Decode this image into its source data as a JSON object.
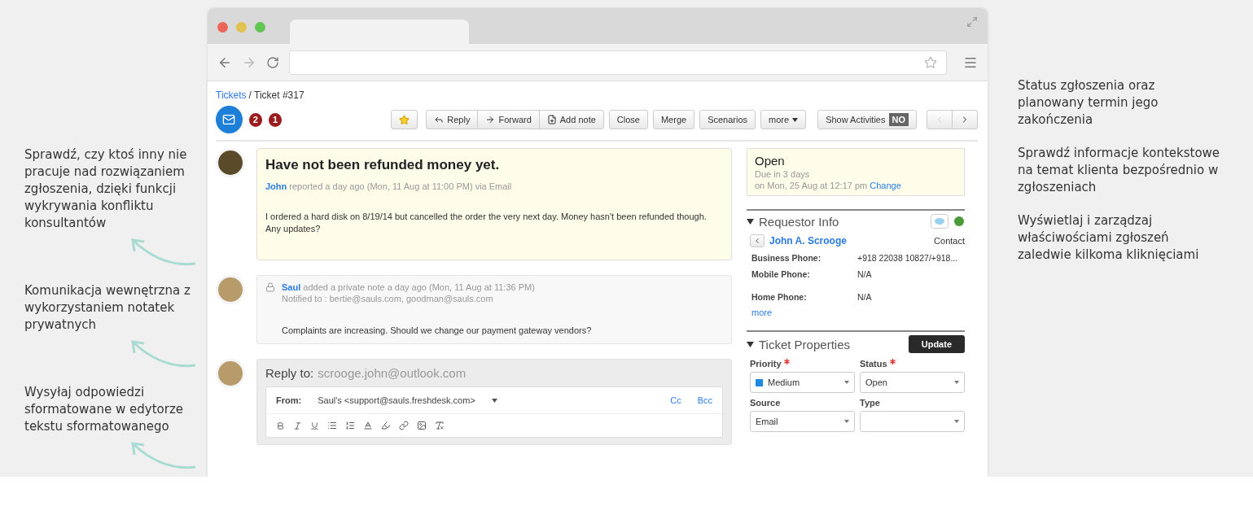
{
  "callouts_left": [
    {
      "text": "Sprawdź, czy ktoś inny nie pracuje nad rozwiązaniem zgłoszenia, dzięki funkcji wykrywania konfliktu konsultantów"
    },
    {
      "text": "Komunikacja wewnętrzna z wykorzystaniem notatek prywatnych"
    },
    {
      "text": "Wysyłaj odpowiedzi sformatowane w edytorze tekstu sformatowanego"
    }
  ],
  "callouts_right": [
    {
      "text": "Status zgłoszenia oraz planowany termin jego zakończenia"
    },
    {
      "text": "Sprawdź informacje kontekstowe na temat klienta bezpośrednio w zgłoszeniach"
    },
    {
      "text": "Wyświetlaj i zarządzaj właściwościami zgłoszeń zaledwie kilkoma kliknięciami"
    }
  ],
  "breadcrumb": {
    "link": "Tickets",
    "current": "/ Ticket #317"
  },
  "badges": [
    {
      "count": "2"
    },
    {
      "count": "1"
    }
  ],
  "toolbar": {
    "buttons": [
      {
        "label": "Reply",
        "kind": "reply"
      },
      {
        "label": "Forward",
        "kind": "forward"
      },
      {
        "label": "Add note",
        "kind": "note"
      },
      {
        "label": "Close",
        "kind": "plain"
      },
      {
        "label": "Merge",
        "kind": "plain"
      },
      {
        "label": "Scenarios",
        "kind": "plain"
      },
      {
        "label": "more",
        "kind": "menu"
      }
    ],
    "activities": {
      "label": "Show Activities",
      "toggle": "NO"
    }
  },
  "ticket": {
    "title": "Have not been refunded money yet.",
    "author": "John",
    "meta": "reported a day ago (Mon, 11 Aug at 11:00 PM) via Email",
    "body": "I ordered a hard disk on 8/19/14 but cancelled the order the very next day. Money hasn't been refunded though. Any updates?"
  },
  "note": {
    "author": "Saul",
    "meta": "added a private note a day ago (Mon, 11 Aug at 11:36 PM)",
    "notified": "Notified to : bertie@sauls.com, goodman@sauls.com",
    "body": "Complaints are increasing. Should we change our payment gateway vendors?"
  },
  "reply": {
    "label": "Reply to:",
    "address": "scrooge.john@outlook.com",
    "from_label": "From:",
    "from_value": "Saul's <support@sauls.freshdesk.com>",
    "cc": "Cc",
    "bcc": "Bcc"
  },
  "status": {
    "state": "Open",
    "due": "Due in 3 days",
    "due_date": "on Mon, 25 Aug at 12:17 pm",
    "change": "Change"
  },
  "requestor": {
    "title": "Requestor Info",
    "name": "John A. Scrooge",
    "contact": "Contact",
    "fields": [
      {
        "label": "Business Phone:",
        "value": "+918 22038 10827/+918..."
      },
      {
        "label": "Mobile Phone:",
        "value": "N/A"
      },
      {
        "label": "Home Phone:",
        "value": "N/A"
      }
    ],
    "more": "more"
  },
  "properties": {
    "title": "Ticket Properties",
    "update": "Update",
    "fields": [
      {
        "label": "Priority",
        "required": true,
        "value": "Medium",
        "color": "#1e88e5"
      },
      {
        "label": "Status",
        "required": true,
        "value": "Open"
      },
      {
        "label": "Source",
        "required": false,
        "value": "Email"
      },
      {
        "label": "Type",
        "required": false
      }
    ]
  }
}
